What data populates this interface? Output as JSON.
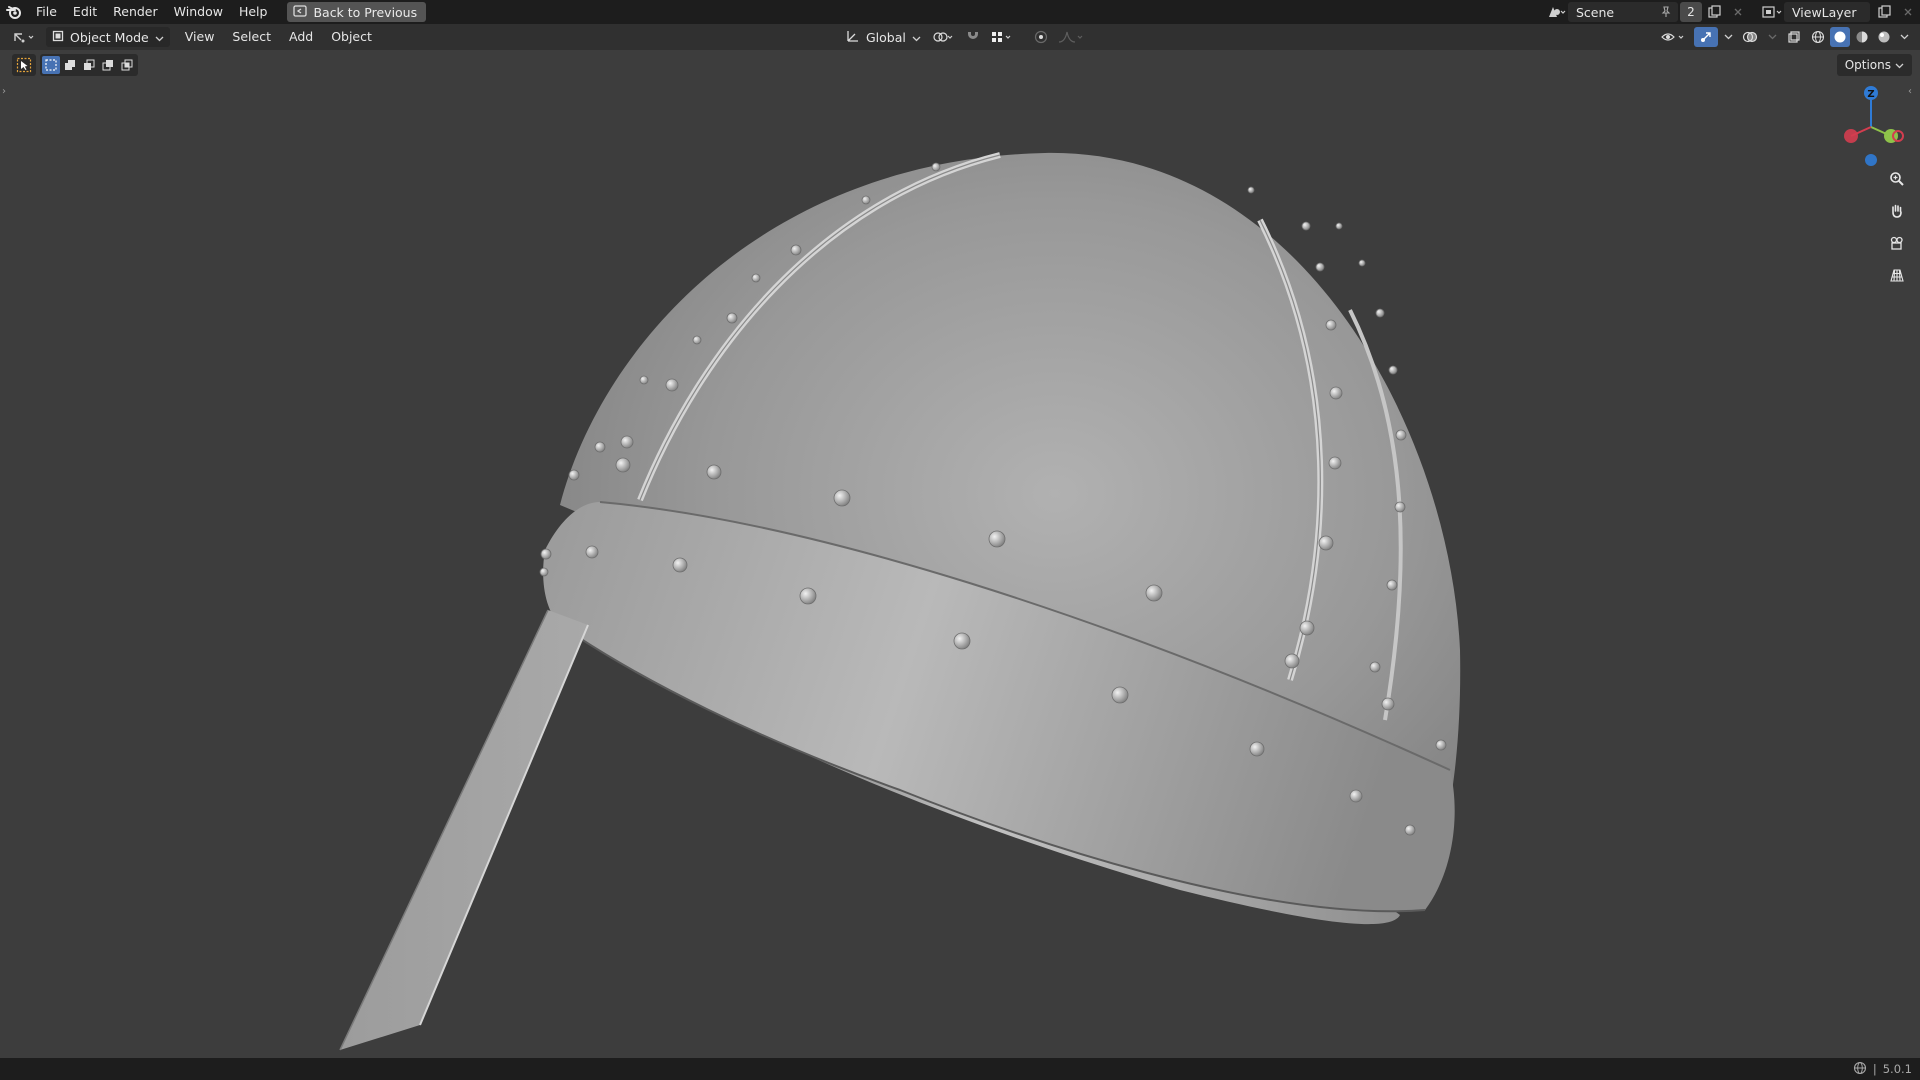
{
  "topbar": {
    "menus": [
      "File",
      "Edit",
      "Render",
      "Window",
      "Help"
    ],
    "back_button": "Back to Previous",
    "scene_name": "Scene",
    "scene_count": "2",
    "view_layer_name": "ViewLayer"
  },
  "header": {
    "mode": "Object Mode",
    "menus": [
      "View",
      "Select",
      "Add",
      "Object"
    ],
    "transform_orientation": "Global"
  },
  "viewport": {
    "options_label": "Options",
    "gizmo_axis_label": "Z",
    "object": "helmet-model"
  },
  "statusbar": {
    "version": "5.0.1"
  },
  "colors": {
    "background": "#3d3d3d",
    "topbar": "#1d1d1d",
    "header": "#303030",
    "axis_x": "#d33d4f",
    "axis_y": "#8fc24a",
    "axis_z": "#2f7bd6",
    "accent": "#4772b3"
  }
}
